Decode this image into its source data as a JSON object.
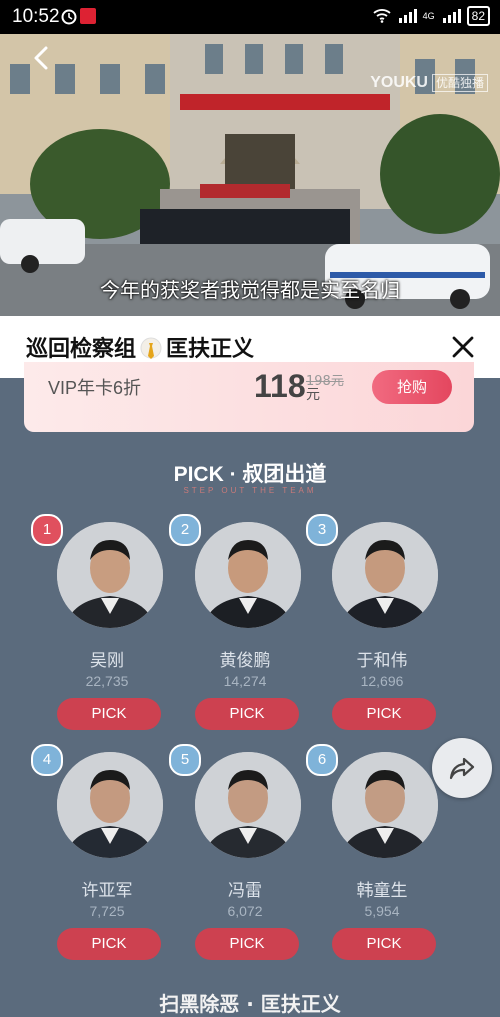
{
  "status_bar": {
    "time": "10:52",
    "battery": "82",
    "network": "4G"
  },
  "video": {
    "subtitle": "今年的获奖者我觉得都是实至名归",
    "watermark": "YOUKU",
    "watermark_tag": "优酷独播"
  },
  "header": {
    "title_left": "巡回检察组",
    "title_right": "匡扶正义"
  },
  "banner": {
    "vip_label": "VIP年卡6折",
    "price": "118",
    "unit": "元",
    "original_price": "198元",
    "buy_label": "抢购"
  },
  "pick": {
    "title": "PICK · 叔团出道",
    "subtitle": "STEP OUT THE TEAM"
  },
  "candidates": [
    {
      "rank": "1",
      "name": "吴刚",
      "votes": "22,735",
      "button": "PICK",
      "rank_color": "#e0505e"
    },
    {
      "rank": "2",
      "name": "黄俊鹏",
      "votes": "14,274",
      "button": "PICK",
      "rank_color": "#7fb3d9"
    },
    {
      "rank": "3",
      "name": "于和伟",
      "votes": "12,696",
      "button": "PICK",
      "rank_color": "#7fb3d9"
    },
    {
      "rank": "4",
      "name": "许亚军",
      "votes": "7,725",
      "button": "PICK",
      "rank_color": "#7fb3d9"
    },
    {
      "rank": "5",
      "name": "冯雷",
      "votes": "6,072",
      "button": "PICK",
      "rank_color": "#7fb3d9"
    },
    {
      "rank": "6",
      "name": "韩童生",
      "votes": "5,954",
      "button": "PICK",
      "rank_color": "#7fb3d9"
    }
  ],
  "bottom_text": "扫黑除恶 · 匡扶正义",
  "icons": [
    "alarm-icon",
    "back-icon",
    "close-icon",
    "share-icon",
    "avatar-icon"
  ]
}
